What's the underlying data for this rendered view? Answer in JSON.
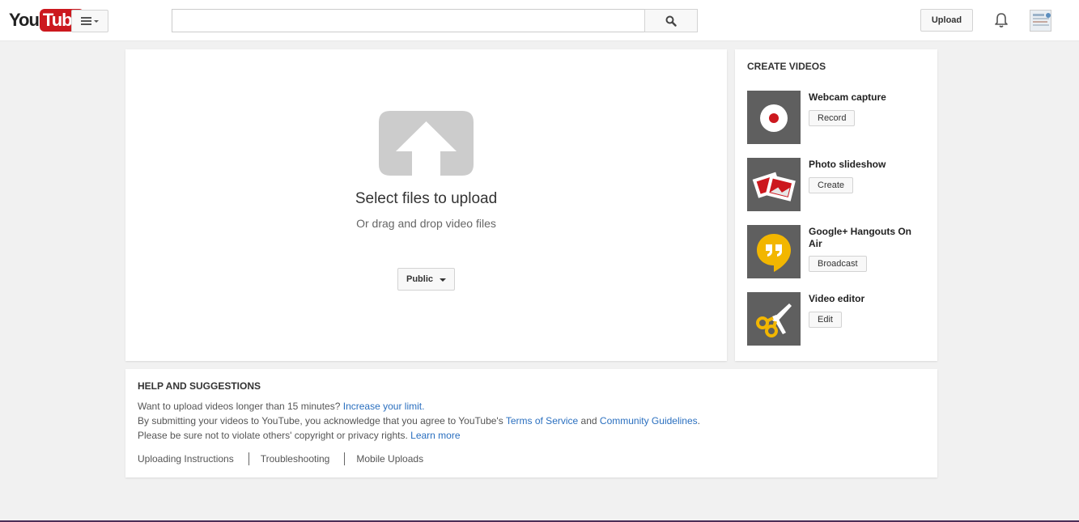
{
  "masthead": {
    "logo_you": "You",
    "logo_tube": "Tube",
    "search_placeholder": "",
    "upload_label": "Upload",
    "icons": [
      "guide-menu-icon",
      "search-icon",
      "bell-icon",
      "avatar"
    ]
  },
  "upload": {
    "title": "Select files to upload",
    "subtitle": "Or drag and drop video files",
    "privacy_value": "Public"
  },
  "create": {
    "heading": "CREATE VIDEOS",
    "items": [
      {
        "title": "Webcam capture",
        "button": "Record",
        "icon": "record-icon"
      },
      {
        "title": "Photo slideshow",
        "button": "Create",
        "icon": "photos-icon"
      },
      {
        "title": "Google+ Hangouts On Air",
        "button": "Broadcast",
        "icon": "hangouts-icon"
      },
      {
        "title": "Video editor",
        "button": "Edit",
        "icon": "scissors-icon"
      }
    ]
  },
  "help": {
    "heading": "HELP AND SUGGESTIONS",
    "line1_text": "Want to upload videos longer than 15 minutes?",
    "line1_link": "Increase your limit.",
    "line2_text": "By submitting your videos to YouTube, you acknowledge that you agree to YouTube's",
    "line2_link1": "Terms of Service",
    "line2_and": "and",
    "line2_link2": "Community Guidelines",
    "line2_end": ".",
    "line3_text": "Please be sure not to violate others' copyright or privacy rights.",
    "line3_link": "Learn more",
    "links": [
      "Uploading Instructions",
      "Troubleshooting",
      "Mobile Uploads"
    ]
  },
  "colors": {
    "brand_red": "#cc181e",
    "link_blue": "#2a6fbf",
    "page_bg": "#f1f1f1",
    "hangouts_yellow": "#f2b600"
  }
}
